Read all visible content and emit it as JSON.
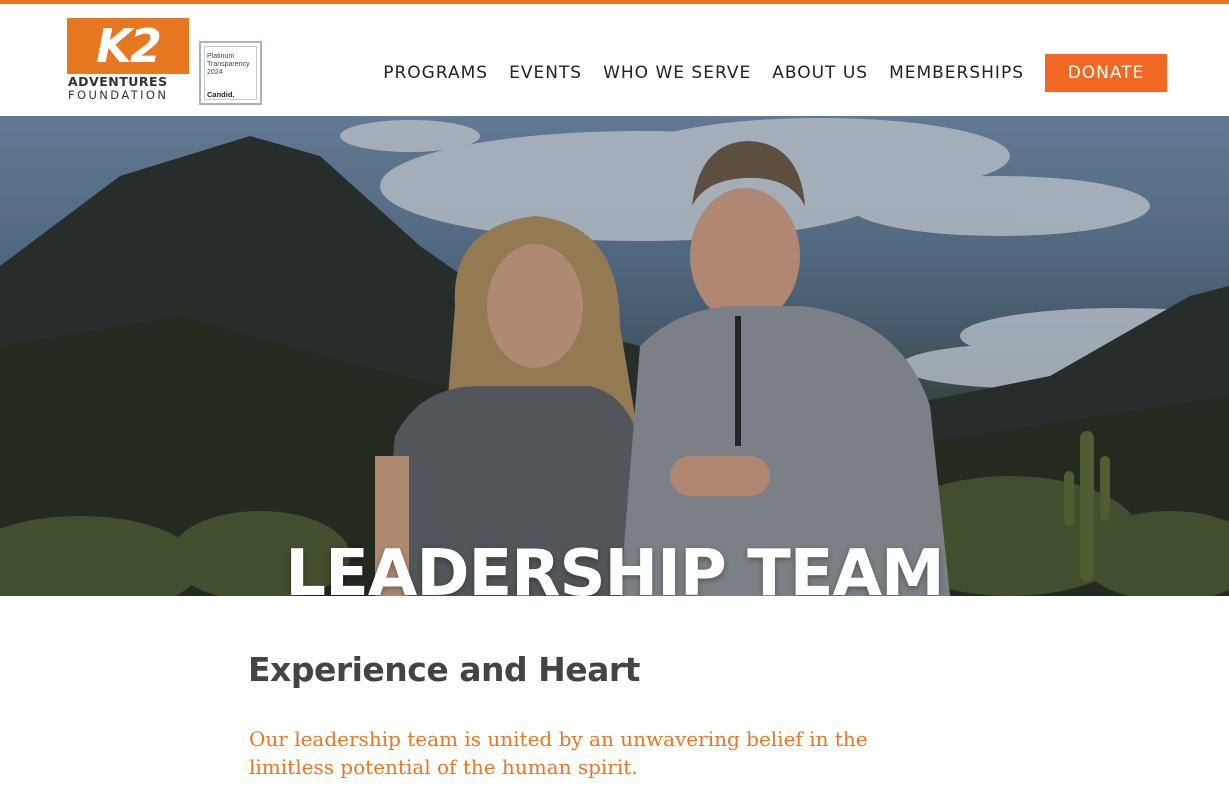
{
  "header": {
    "logo": {
      "mark": "K2",
      "line1": "ADVENTURES",
      "line2": "FOUNDATION",
      "alt_icon": "k2-adventures-foundation-logo"
    },
    "seal": {
      "line1": "Platinum",
      "line2": "Transparency",
      "line3": "2024",
      "brand": "Candid."
    },
    "nav": {
      "items": [
        {
          "label": "PROGRAMS"
        },
        {
          "label": "EVENTS"
        },
        {
          "label": "WHO WE SERVE"
        },
        {
          "label": "ABOUT US"
        },
        {
          "label": "MEMBERSHIPS"
        }
      ],
      "donate_label": "DONATE"
    }
  },
  "hero": {
    "title": "LEADERSHIP TEAM"
  },
  "content": {
    "heading": "Experience and Heart",
    "lead": "Our leadership team is united by an unwavering belief in the limitless potential of the human spirit."
  },
  "colors": {
    "accent": "#e87722",
    "donate_bg": "#f26722",
    "text_dark": "#333333"
  }
}
